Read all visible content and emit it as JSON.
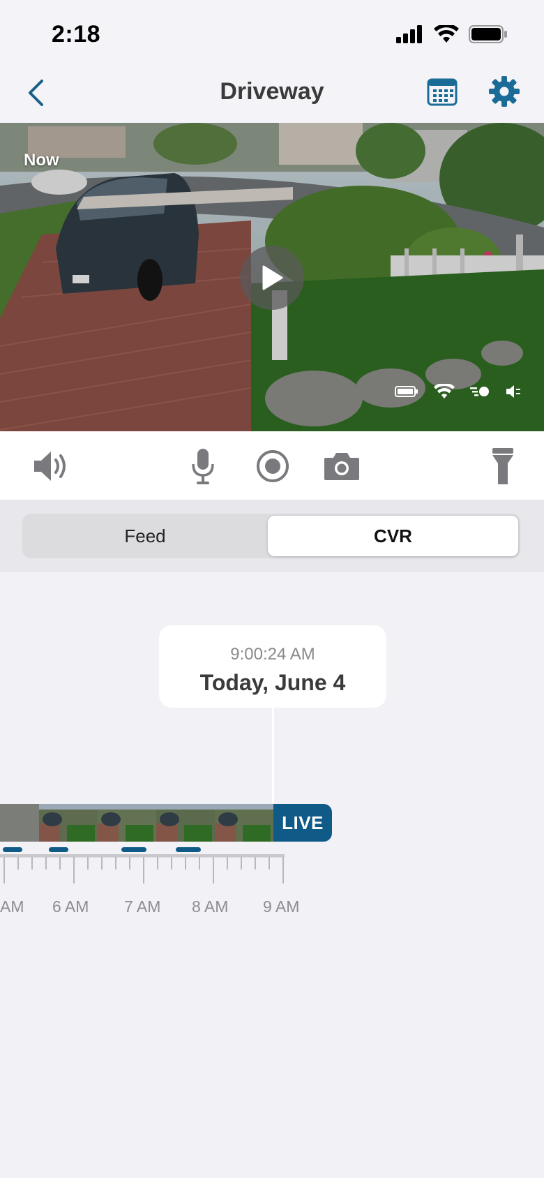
{
  "status_bar": {
    "time": "2:18"
  },
  "nav": {
    "title": "Driveway",
    "back_icon": "chevron-left-icon",
    "calendar_icon": "calendar-icon",
    "settings_icon": "gear-icon"
  },
  "video": {
    "now_label": "Now"
  },
  "segments": {
    "feed_label": "Feed",
    "cvr_label": "CVR",
    "selected": "CVR"
  },
  "timeline": {
    "time": "9:00:24 AM",
    "date": "Today, June 4",
    "live_label": "LIVE",
    "hour_labels": [
      "AM",
      "6 AM",
      "7 AM",
      "8 AM",
      "9 AM"
    ]
  },
  "colors": {
    "accent": "#0f5a86",
    "background": "#f1f1f6"
  }
}
